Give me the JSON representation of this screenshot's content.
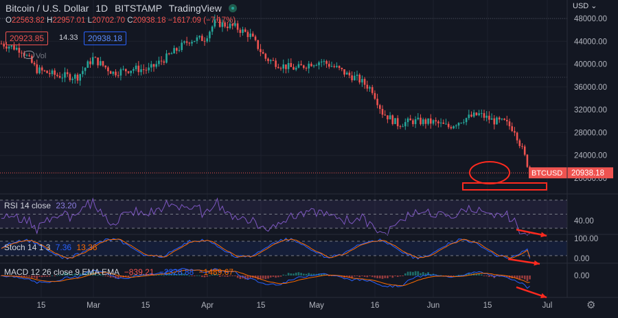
{
  "header": {
    "symbol_name": "Bitcoin / U.S. Dollar",
    "interval": "1D",
    "exchange": "BITSTAMP",
    "source": "TradingView"
  },
  "ohlc": {
    "open_label": "O",
    "open": "22563.82",
    "high_label": "H",
    "high": "22957.01",
    "low_label": "L",
    "low": "20702.70",
    "close_label": "C",
    "close": "20938.18",
    "change": "−1617.09 (−7.17%)"
  },
  "quote": {
    "bid": "20923.85",
    "spread": "14.33",
    "ask": "20938.18"
  },
  "volume_label": "Vol",
  "currency": "USD",
  "price_tag": {
    "symbol": "BTCUSD",
    "value": "20938.18"
  },
  "rsi": {
    "label": "RSI 14 close",
    "value": "23.20"
  },
  "stoch": {
    "label": "Stoch 14 1 3",
    "k": "7.36",
    "d": "13.36"
  },
  "macd": {
    "label": "MACD 12 26 close 9 EMA EMA",
    "hist": "−839.21",
    "macd": "−2328.88",
    "signal": "−1489.67"
  },
  "colors": {
    "up": "#26a69a",
    "down": "#ef5350",
    "bg": "#131722",
    "annotation": "#ff2a1f"
  },
  "chart_data": {
    "type": "candlestick",
    "title": "Bitcoin / U.S. Dollar 1D BITSTAMP",
    "x_ticks": [
      "15",
      "Mar",
      "15",
      "Apr",
      "15",
      "May",
      "16",
      "Jun",
      "15",
      "Jul"
    ],
    "y_ticks": [
      "20000.00",
      "24000.00",
      "28000.00",
      "32000.00",
      "36000.00",
      "40000.00",
      "44000.00",
      "48000.00"
    ],
    "ylim": [
      17000,
      49500
    ],
    "approx_close_path": [
      [
        0,
        43600
      ],
      [
        8,
        42500
      ],
      [
        14,
        39000
      ],
      [
        22,
        38000
      ],
      [
        30,
        37800
      ],
      [
        36,
        41000
      ],
      [
        44,
        38500
      ],
      [
        52,
        39200
      ],
      [
        58,
        39000
      ],
      [
        66,
        41500
      ],
      [
        74,
        44200
      ],
      [
        80,
        44500
      ],
      [
        84,
        47300
      ],
      [
        92,
        46500
      ],
      [
        98,
        45000
      ],
      [
        104,
        41000
      ],
      [
        110,
        39800
      ],
      [
        116,
        39200
      ],
      [
        122,
        40200
      ],
      [
        126,
        40500
      ],
      [
        132,
        39300
      ],
      [
        136,
        38200
      ],
      [
        140,
        37500
      ],
      [
        146,
        35500
      ],
      [
        150,
        31500
      ],
      [
        156,
        29500
      ],
      [
        162,
        30000
      ],
      [
        170,
        29800
      ],
      [
        176,
        29000
      ],
      [
        182,
        30400
      ],
      [
        188,
        31200
      ],
      [
        194,
        30000
      ],
      [
        198,
        29800
      ],
      [
        202,
        28500
      ],
      [
        205,
        25000
      ],
      [
        207,
        22500
      ],
      [
        208,
        20938
      ]
    ],
    "rsi_last": 23.2,
    "rsi_bands": [
      30,
      70
    ],
    "rsi_axis_ticks": [
      "40.00"
    ],
    "stoch_k_last": 7.36,
    "stoch_d_last": 13.36,
    "stoch_axis_ticks": [
      "100.00",
      "0.00"
    ],
    "macd_last": -2328.88,
    "macd_signal_last": -1489.67,
    "macd_hist_last": -839.21,
    "macd_axis_ticks": [
      "0.00"
    ],
    "current_price": 20938.18
  }
}
